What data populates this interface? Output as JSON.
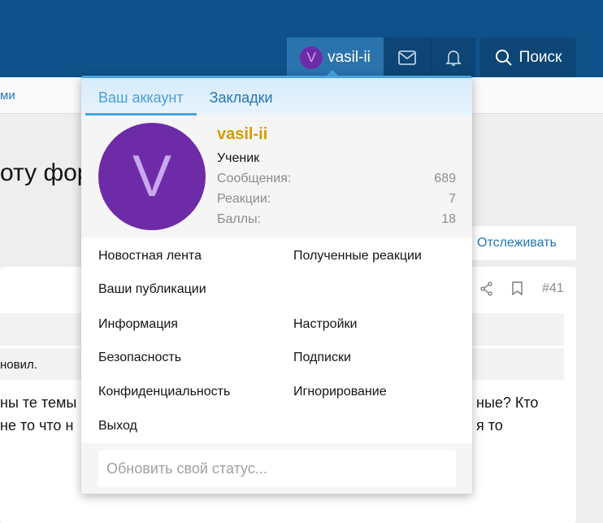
{
  "header": {
    "username": "vasil-ii",
    "avatar_letter": "V",
    "search_label": "Поиск"
  },
  "nav": {
    "partial": "ми"
  },
  "page": {
    "title_partial": "оту фор",
    "follow": "Отслеживать",
    "post_number": "#41",
    "notice_partial": "новил.",
    "body_line1_left": "ны те темы",
    "body_line1_right": "ные? Кто",
    "body_line2_left": "не то что н",
    "body_line2_right": "я то"
  },
  "popup": {
    "tabs": [
      "Ваш аккаунт",
      "Закладки"
    ],
    "username": "vasil-ii",
    "avatar_letter": "V",
    "user_title": "Ученик",
    "stats": [
      {
        "label": "Сообщения:",
        "value": "689"
      },
      {
        "label": "Реакции:",
        "value": "7"
      },
      {
        "label": "Баллы:",
        "value": "18"
      }
    ],
    "links_left": [
      "Новостная лента",
      "Ваши публикации",
      "Информация",
      "Безопасность",
      "Конфиденциальность",
      "Выход"
    ],
    "links_right": [
      "Полученные реакции",
      "",
      "Настройки",
      "Подписки",
      "Игнорирование",
      ""
    ],
    "status_placeholder": "Обновить свой статус..."
  },
  "colors": {
    "header": "#0f5289",
    "accent": "#2577b1",
    "username": "#d59b00",
    "avatar": "#6e2ba8"
  }
}
